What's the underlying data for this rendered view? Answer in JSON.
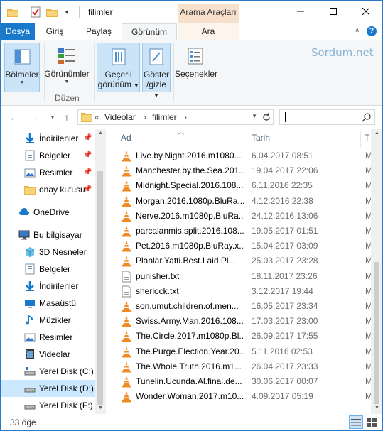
{
  "window": {
    "title": "filimler",
    "context_tab": "Arama Araçları",
    "accent_color": "#1979ca",
    "buttons": {
      "minimize": "—",
      "maximize": "☐",
      "close": "✕"
    }
  },
  "ribbon_tabs": [
    {
      "label": "Dosya"
    },
    {
      "label": "Giriş"
    },
    {
      "label": "Paylaş"
    },
    {
      "label": "Görünüm"
    },
    {
      "label": "Ara"
    }
  ],
  "ribbon": {
    "bolmeler": "Bölmeler",
    "gorunumler": "Görünümler",
    "duzen": "Düzen",
    "gecerli_line1": "Geçerli",
    "gecerli_line2": "görünüm",
    "goster_line1": "Göster",
    "goster_line2": "/gizle",
    "secenekler": "Seçenekler",
    "brand": "Sordum.net"
  },
  "address": {
    "overflow": "«",
    "crumbs": [
      "Videolar",
      "filimler"
    ],
    "separator": "›",
    "search_placeholder": ""
  },
  "nav": {
    "quick_access": [
      {
        "label": "İndirilenler",
        "icon": "download-arrow-icon",
        "pinned": true
      },
      {
        "label": "Belgeler",
        "icon": "document-icon",
        "pinned": true
      },
      {
        "label": "Resimler",
        "icon": "pictures-icon",
        "pinned": true
      },
      {
        "label": "onay kutusu",
        "icon": "folder-icon",
        "pinned": true
      }
    ],
    "onedrive": "OneDrive",
    "this_pc": "Bu bilgisayar",
    "pc_items": [
      {
        "label": "3D Nesneler",
        "icon": "cube-3d-icon"
      },
      {
        "label": "Belgeler",
        "icon": "document-icon"
      },
      {
        "label": "İndirilenler",
        "icon": "download-arrow-icon"
      },
      {
        "label": "Masaüstü",
        "icon": "desktop-icon"
      },
      {
        "label": "Müzikler",
        "icon": "music-note-icon"
      },
      {
        "label": "Resimler",
        "icon": "pictures-icon"
      },
      {
        "label": "Videolar",
        "icon": "film-icon"
      },
      {
        "label": "Yerel Disk (C:)",
        "icon": "drive-icon"
      },
      {
        "label": "Yerel Disk (D:)",
        "icon": "drive-icon",
        "selected": true
      },
      {
        "label": "Yerel Disk (F:)",
        "icon": "drive-icon"
      }
    ]
  },
  "columns": {
    "name": "Ad",
    "date": "Tarih",
    "type": "T"
  },
  "files": [
    {
      "name": "Live.by.Night.2016.m1080...",
      "date": "6.04.2017 08:51",
      "type": "M",
      "icon": "vlc-cone-icon"
    },
    {
      "name": "Manchester.by.the.Sea.201...",
      "date": "19.04.2017 22:06",
      "type": "M",
      "icon": "vlc-cone-icon"
    },
    {
      "name": "Midnight.Special.2016.108...",
      "date": "6.11.2016 22:35",
      "type": "M",
      "icon": "vlc-cone-icon"
    },
    {
      "name": "Morgan.2016.1080p.BluRa...",
      "date": "4.12.2016 22:38",
      "type": "M",
      "icon": "vlc-cone-icon"
    },
    {
      "name": "Nerve.2016.m1080p.BluRa...",
      "date": "24.12.2016 13:06",
      "type": "M",
      "icon": "vlc-cone-icon"
    },
    {
      "name": "parcalanmis.split.2016.108...",
      "date": "19.05.2017 01:51",
      "type": "M",
      "icon": "vlc-cone-icon"
    },
    {
      "name": "Pet.2016.m1080p.BluRay.x...",
      "date": "15.04.2017 03:09",
      "type": "M",
      "icon": "vlc-cone-icon"
    },
    {
      "name": "Planlar.Yatti.Best.Laid.Pl...",
      "date": "25.03.2017 23:28",
      "type": "M",
      "icon": "vlc-cone-icon"
    },
    {
      "name": "punisher.txt",
      "date": "18.11.2017 23:26",
      "type": "M",
      "icon": "text-file-icon"
    },
    {
      "name": "sherlock.txt",
      "date": "3.12.2017 19:44",
      "type": "M",
      "icon": "text-file-icon"
    },
    {
      "name": "son.umut.children.of.men...",
      "date": "16.05.2017 23:34",
      "type": "M",
      "icon": "vlc-cone-icon"
    },
    {
      "name": "Swiss.Army.Man.2016.108...",
      "date": "17.03.2017 23:00",
      "type": "M",
      "icon": "vlc-cone-icon"
    },
    {
      "name": "The.Circle.2017.m1080p.Bl...",
      "date": "26.09.2017 17:55",
      "type": "M",
      "icon": "vlc-cone-icon"
    },
    {
      "name": "The.Purge.Election.Year.20...",
      "date": "5.11.2016 02:53",
      "type": "M",
      "icon": "vlc-cone-icon"
    },
    {
      "name": "The.Whole.Truth.2016.m1...",
      "date": "26.04.2017 23:33",
      "type": "M",
      "icon": "vlc-cone-icon"
    },
    {
      "name": "Tunelin.Ucunda.Al.final.de...",
      "date": "30.06.2017 00:07",
      "type": "M",
      "icon": "vlc-cone-icon"
    },
    {
      "name": "Wonder.Woman.2017.m10...",
      "date": "4.09.2017 05:19",
      "type": "M",
      "icon": "vlc-cone-icon"
    }
  ],
  "status": {
    "count": "33 öğe"
  }
}
